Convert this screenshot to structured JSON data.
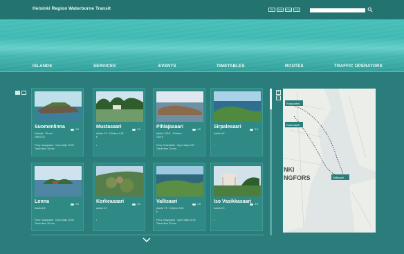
{
  "header": {
    "brand": "Helsinki Region Waterborne Transit",
    "langs": [
      "fin",
      "swe",
      "eng",
      "rus"
    ],
    "search_placeholder": ""
  },
  "nav": [
    "ISLANDS",
    "SERVICES",
    "EVENTS",
    "TIMETABLES",
    "ROUTES",
    "TRAFFIC OPERATORS"
  ],
  "cards": [
    {
      "name": "Suomenlinna",
      "meta": "Helsinki · 20 min · UNESCO",
      "rating": "4.5",
      "info": "Ferry: Kauppatori · Open daily 10:00 · Travel time 15 min"
    },
    {
      "name": "Mustasaari",
      "meta": "Adults 3 € · Children 1,50 €",
      "rating": "3.5",
      "info": "•"
    },
    {
      "name": "Pihlajasaari",
      "meta": "Adults 7,50 € · Children 3,80 €",
      "rating": "4.5",
      "info": "Ferry: Ruoholahti · Open daily 9:00 · Travel time 10 min"
    },
    {
      "name": "Sirpalesaari",
      "meta": "Adults 6 €",
      "rating": "3.5",
      "info": "•"
    },
    {
      "name": "Lonna",
      "meta": "Adults 6 €",
      "rating": "4.0",
      "info": "Ferry: Kauppatori · Open daily 10:00 · Travel time 10 min"
    },
    {
      "name": "Korkeasaari",
      "meta": "Adults 6 €",
      "rating": "4.0",
      "info": "•"
    },
    {
      "name": "Vallisaari",
      "meta": "Adults 7 € · Children 3,50 €",
      "rating": "4.5",
      "info": "Ferry: Kauppatori · Open daily 10:00 · Travel time 20 min"
    },
    {
      "name": "Iso Vasikkasaari",
      "meta": "Adults 5 €",
      "rating": "3.5",
      "info": "•"
    }
  ],
  "map": {
    "labels": [
      "Kauppatori",
      "Ruoholahti",
      "Vallisaari"
    ],
    "city": [
      "NKI",
      "NGFORS"
    ]
  },
  "colors": {
    "accent": "#2a7d7a",
    "hero": "#44bfb9",
    "water_map": "#dfe6e5"
  }
}
